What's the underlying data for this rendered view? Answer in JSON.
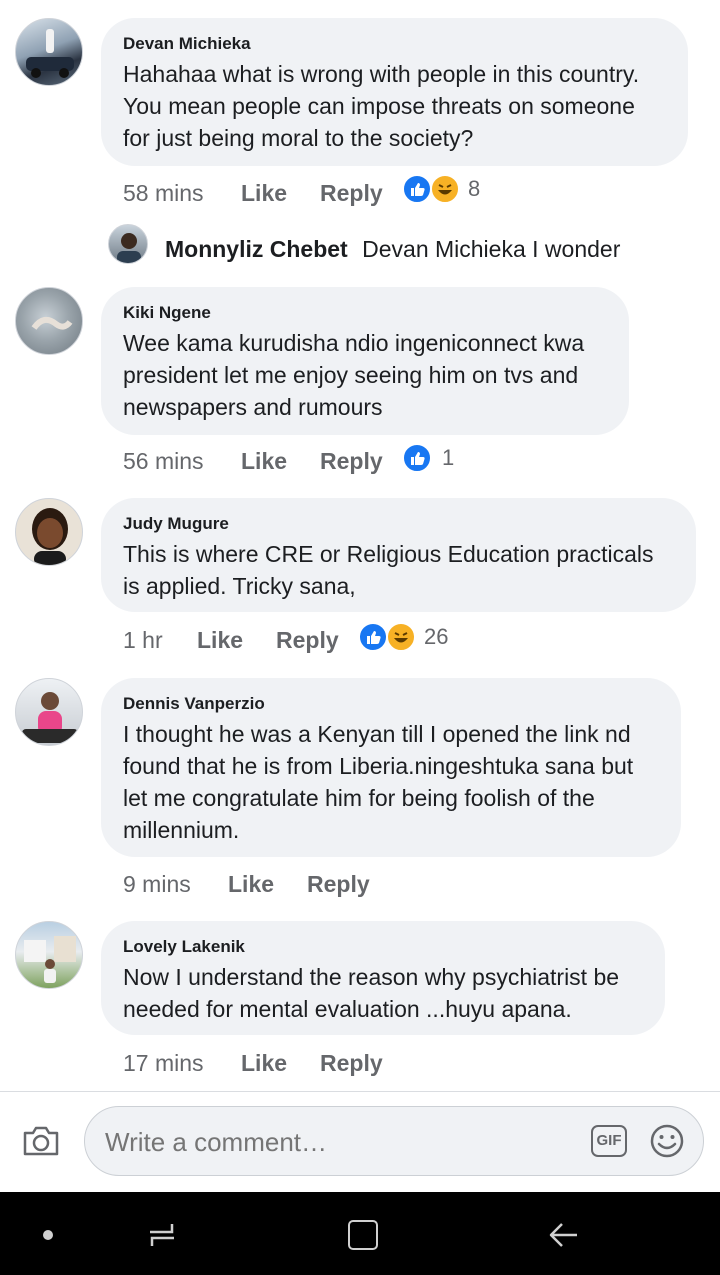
{
  "comments": [
    {
      "author": "Devan Michieka",
      "text": "Hahahaa what is wrong with people in this country. You mean people can impose threats on someone for just being moral to the society?",
      "time": "58 mins",
      "like": "Like",
      "reply": "Reply",
      "reactions": [
        "like",
        "haha"
      ],
      "reaction_count": "8"
    },
    {
      "author": "Kiki Ngene",
      "text": "Wee kama kurudisha ndio ingeniconnect kwa president let me enjoy seeing him on tvs and newspapers and rumours",
      "time": "56 mins",
      "like": "Like",
      "reply": "Reply",
      "reactions": [
        "like"
      ],
      "reaction_count": "1"
    },
    {
      "author": "Judy Mugure",
      "text": "This is where CRE or Religious Education practicals is applied.   Tricky sana,",
      "time": "1 hr",
      "like": "Like",
      "reply": "Reply",
      "reactions": [
        "like",
        "haha"
      ],
      "reaction_count": "26"
    },
    {
      "author": "Dennis Vanperzio",
      "text": "I thought he was a Kenyan till I opened the link nd found that he is from Liberia.ningeshtuka sana but let me congratulate him for being foolish of the millennium.",
      "time": "9 mins",
      "like": "Like",
      "reply": "Reply"
    },
    {
      "author": "Lovely Lakenik",
      "text": "Now I understand the reason why psychiatrist be needed for mental evaluation ...huyu apana.",
      "time": "17 mins",
      "like": "Like",
      "reply": "Reply"
    }
  ],
  "reply_preview": {
    "author": "Monnyliz Chebet",
    "text": "Devan Michieka I wonder"
  },
  "composer": {
    "placeholder": "Write a comment…",
    "gif_label": "GIF",
    "icons": [
      "camera-icon",
      "gif-icon",
      "emoji-icon"
    ]
  },
  "navbar": {
    "icons": [
      "home-dot-icon",
      "recent-apps-icon",
      "overview-square-icon",
      "back-arrow-icon"
    ]
  },
  "colors": {
    "bubble": "#f0f2f5",
    "like_blue": "#1877f2",
    "haha_yellow": "#f7b125",
    "meta_grey": "#65676b"
  }
}
